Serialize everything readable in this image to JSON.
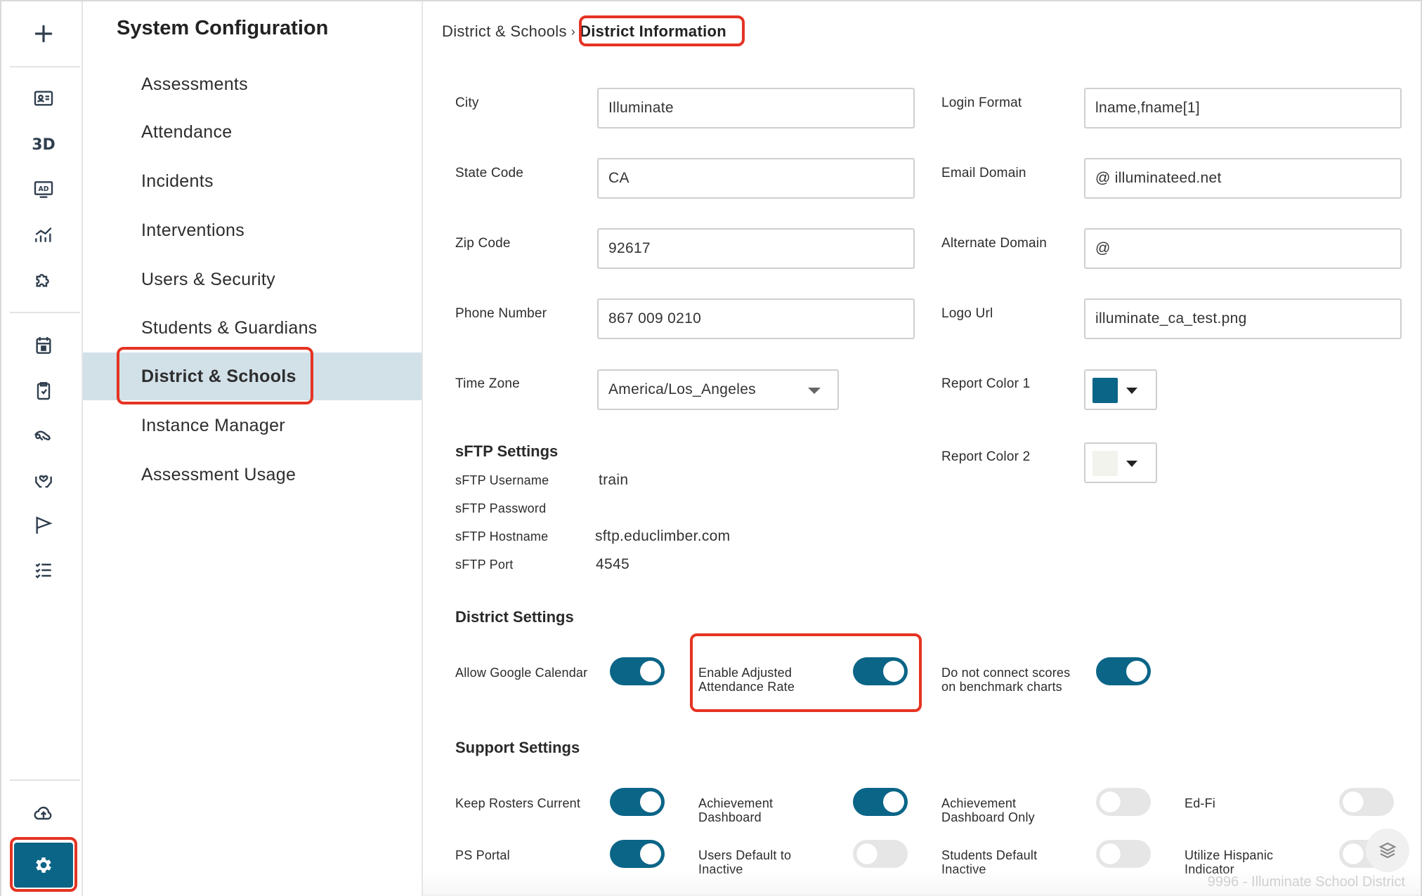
{
  "rail": {
    "items": [
      {
        "name": "add-icon"
      },
      {
        "name": "id-card-icon"
      },
      {
        "name": "3d-icon",
        "text": "3D"
      },
      {
        "name": "ad-screen-icon"
      },
      {
        "name": "analytics-icon"
      },
      {
        "name": "puzzle-icon"
      },
      {
        "name": "calendar-icon"
      },
      {
        "name": "clipboard-icon"
      },
      {
        "name": "handshake-icon"
      },
      {
        "name": "care-hands-icon"
      },
      {
        "name": "flag-icon"
      },
      {
        "name": "checklist-icon"
      },
      {
        "name": "cloud-upload-icon"
      },
      {
        "name": "gear-icon"
      }
    ],
    "accent": "#0b6587"
  },
  "config": {
    "title": "System Configuration",
    "items": [
      {
        "label": "Assessments"
      },
      {
        "label": "Attendance"
      },
      {
        "label": "Incidents"
      },
      {
        "label": "Interventions"
      },
      {
        "label": "Users & Security"
      },
      {
        "label": "Students & Guardians"
      },
      {
        "label": "District & Schools",
        "active": true
      },
      {
        "label": "Instance Manager"
      },
      {
        "label": "Assessment Usage"
      }
    ]
  },
  "breadcrumb": {
    "parent": "District & Schools",
    "separator": "›",
    "current": "District Information"
  },
  "fields": {
    "city": {
      "label": "City",
      "value": "Illuminate"
    },
    "state_code": {
      "label": "State Code",
      "value": "CA"
    },
    "zip_code": {
      "label": "Zip Code",
      "value": "92617"
    },
    "phone_number": {
      "label": "Phone Number",
      "value": "867 009 0210"
    },
    "time_zone": {
      "label": "Time Zone",
      "value": "America/Los_Angeles"
    },
    "login_format": {
      "label": "Login Format",
      "value": "lname,fname[1]"
    },
    "email_domain": {
      "label": "Email Domain",
      "value": "@ illuminateed.net"
    },
    "alternate_domain": {
      "label": "Alternate Domain",
      "value": "@"
    },
    "logo_url": {
      "label": "Logo Url",
      "value": "illuminate_ca_test.png"
    },
    "report_color_1": {
      "label": "Report Color 1",
      "color": "#0b6587"
    },
    "report_color_2": {
      "label": "Report Color 2",
      "color": "#f3f3ee"
    }
  },
  "sftp": {
    "title": "sFTP Settings",
    "username_label": "sFTP Username",
    "username": "train",
    "password_label": "sFTP Password",
    "password": "",
    "hostname_label": "sFTP Hostname",
    "hostname": "sftp.educlimber.com",
    "port_label": "sFTP Port",
    "port": "4545"
  },
  "district_settings": {
    "title": "District Settings",
    "allow_google_calendar": {
      "line1": "Allow Google Calendar",
      "line2": "",
      "on": true
    },
    "enable_adjusted_attendance": {
      "line1": "Enable Adjusted",
      "line2": "Attendance Rate",
      "on": true
    },
    "no_connect_scores": {
      "line1": "Do not connect scores",
      "line2": "on benchmark charts",
      "on": true
    }
  },
  "support_settings": {
    "title": "Support Settings",
    "keep_rosters_current": {
      "line1": "Keep Rosters Current",
      "line2": "",
      "on": true
    },
    "achievement_dashboard": {
      "line1": "Achievement",
      "line2": "Dashboard",
      "on": true
    },
    "achievement_dashboard_only": {
      "line1": "Achievement",
      "line2": "Dashboard Only",
      "on": false
    },
    "ed_fi": {
      "line1": "Ed-Fi",
      "line2": "",
      "on": false
    },
    "ps_portal": {
      "line1": "PS Portal",
      "line2": "",
      "on": true
    },
    "users_default_inactive": {
      "line1": "Users Default to",
      "line2": "Inactive",
      "on": false
    },
    "students_default_inactive": {
      "line1": "Students Default",
      "line2": "Inactive",
      "on": false
    },
    "utilize_hispanic_indicator": {
      "line1": "Utilize Hispanic",
      "line2": "Indicator",
      "on": false
    }
  },
  "footer": {
    "text": "9996 - Illuminate School District"
  }
}
